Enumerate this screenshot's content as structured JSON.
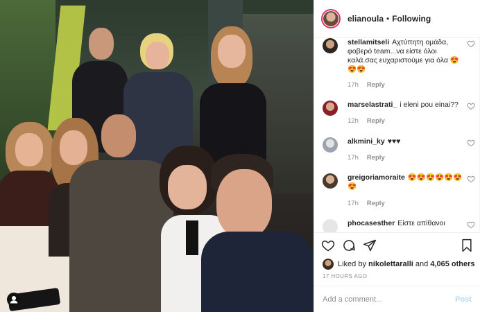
{
  "header": {
    "username": "elianoula",
    "separator": "•",
    "follow_label": "Following"
  },
  "comments": [
    {
      "user": "stellamitseli",
      "text": "Αχτύπητη ομάδα, φοβερό team...να είστε όλοι καλά.σας ευχαριστούμε για όλα 😍😍😍",
      "time": "17h",
      "reply": "Reply"
    },
    {
      "user": "marselastrati_",
      "text": "i eleni pou einai??",
      "time": "12h",
      "reply": "Reply"
    },
    {
      "user": "alkmini_ky",
      "text": "♥♥♥",
      "time": "17h",
      "reply": "Reply"
    },
    {
      "user": "greigoriamoraite",
      "text": "😍😍😍😍😍😍😍",
      "time": "17h",
      "reply": "Reply"
    },
    {
      "user": "phocasesther",
      "text": "Είστε απίθανοι",
      "time": "",
      "reply": ""
    }
  ],
  "actions": {
    "icons": [
      "heart-icon",
      "comment-icon",
      "share-icon",
      "bookmark-icon"
    ]
  },
  "likes": {
    "prefix": "Liked by ",
    "user": "nikolettaralli",
    "middle": " and ",
    "count": "4,065 others"
  },
  "timestamp": "17 HOURS AGO",
  "add_comment": {
    "placeholder": "Add a comment...",
    "post_label": "Post"
  },
  "colors": {
    "text": "#262626",
    "muted": "#8e8e8e",
    "post_disabled": "#b3dbff",
    "border": "#efefef"
  }
}
